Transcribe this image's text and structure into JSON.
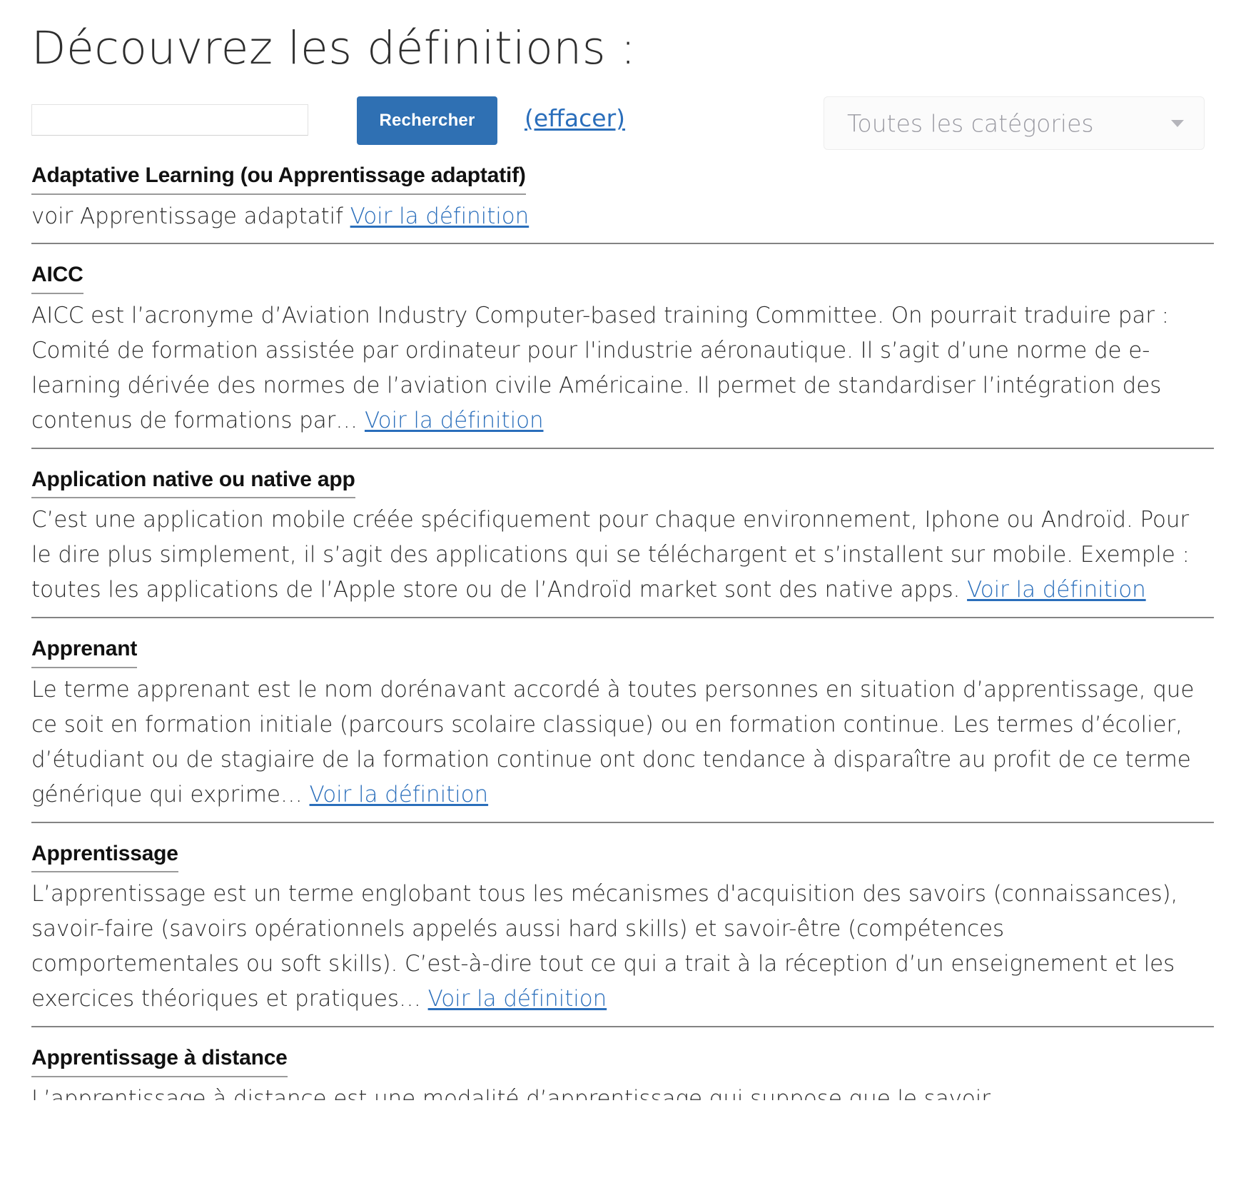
{
  "page": {
    "title": "Découvrez les définitions :"
  },
  "search": {
    "input_value": "",
    "input_placeholder": "",
    "submit_label": "Rechercher",
    "clear_label": "(effacer)",
    "category_selected": "Toutes les catégories",
    "caret_icon": "chevron-down-icon"
  },
  "colors": {
    "accent_blue": "#2f70b3",
    "link_blue": "#2a6ebb",
    "divider_gray": "#838383",
    "term_underline_gray": "#9a9a9a",
    "text": "#2b2b2b",
    "placeholder_gray": "#9a9aa2"
  },
  "link_label": "Voir la définition",
  "definitions": [
    {
      "term": "Adaptative Learning (ou Apprentissage adaptatif)",
      "excerpt": "voir Apprentissage adaptatif ",
      "link": "Voir la définition",
      "clipped": false
    },
    {
      "term": "AICC",
      "excerpt": "AICC est l’acronyme d’Aviation Industry Computer-based training Committee. On pourrait traduire par : Comité de formation assistée par ordinateur pour l'industrie aéronautique.    Il s’agit d’une norme de e-learning dérivée des normes de l’aviation civile Américaine. Il permet de standardiser l’intégration des contenus de formations par… ",
      "link": "Voir la définition",
      "clipped": false
    },
    {
      "term": "Application native ou native app",
      "excerpt": "C’est une application mobile créée spécifiquement pour chaque environnement, Iphone ou Androïd. Pour le dire plus simplement, il s’agit des applications qui se téléchargent et s’installent sur mobile.  Exemple : toutes les applications de l’Apple store ou de l’Androïd market sont des native apps. ",
      "link": "Voir la définition",
      "clipped": false
    },
    {
      "term": "Apprenant",
      "excerpt": "Le terme apprenant est le nom dorénavant accordé à toutes personnes en situation d’apprentissage, que ce soit en formation initiale (parcours scolaire classique) ou en formation continue. Les termes d’écolier, d’étudiant ou de stagiaire de la formation continue ont donc tendance à disparaître au profit de ce terme générique qui exprime… ",
      "link": "Voir la définition",
      "clipped": false
    },
    {
      "term": "Apprentissage",
      "excerpt": "  L’apprentissage est un terme englobant tous les mécanismes d'acquisition des savoirs (connaissances), savoir-faire (savoirs opérationnels appelés aussi hard skills) et savoir-être (compétences comportementales ou soft skills). C’est-à-dire tout ce qui a trait à la réception d’un enseignement et les exercices théoriques et pratiques… ",
      "link": "Voir la définition",
      "clipped": false
    },
    {
      "term": "Apprentissage à distance",
      "excerpt": "L’apprentissage à distance est une modalité d’apprentissage qui suppose que le savoir ",
      "link": "",
      "clipped": true
    }
  ]
}
